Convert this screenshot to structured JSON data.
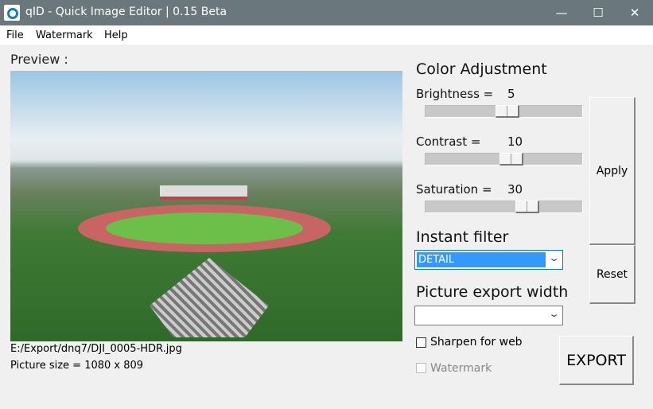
{
  "window": {
    "title": "qID - Quick Image Editor | 0.15 Beta",
    "minimize": "—",
    "maximize": "☐",
    "close": "✕"
  },
  "menu": [
    "File",
    "Watermark",
    "Help"
  ],
  "preview": {
    "label": "Preview  :",
    "file_path": "E:/Export/dnq7/DJI_0005-HDR.jpg",
    "picture_size": "Picture size = 1080 x 809"
  },
  "color_adjustment": {
    "title": "Color Adjustment",
    "sliders": [
      {
        "label": "Brightness =",
        "value": "5",
        "fraction": 0.525
      },
      {
        "label": "Contrast =",
        "value": "10",
        "fraction": 0.55
      },
      {
        "label": "Saturation =",
        "value": "30",
        "fraction": 0.65
      }
    ]
  },
  "buttons": {
    "apply": "Apply",
    "reset": "Reset",
    "export": "EXPORT"
  },
  "instant_filter": {
    "title": "Instant filter",
    "selected": "DETAIL"
  },
  "export_width": {
    "title": "Picture export width",
    "selected": ""
  },
  "checkboxes": {
    "sharpen": {
      "label": "Sharpen for web",
      "checked": false
    },
    "watermark": {
      "label": "Watermark",
      "checked": false,
      "disabled": true
    }
  }
}
